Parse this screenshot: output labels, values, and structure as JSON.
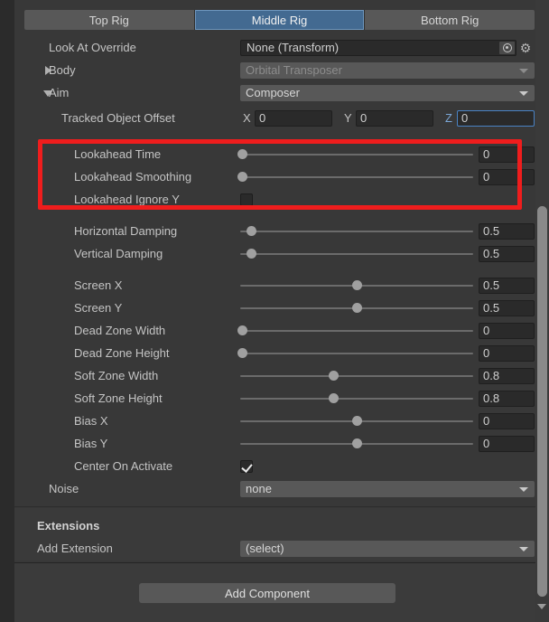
{
  "tabs": [
    {
      "label": "Top Rig",
      "active": false
    },
    {
      "label": "Middle Rig",
      "active": true
    },
    {
      "label": "Bottom Rig",
      "active": false
    }
  ],
  "look_at_override": {
    "label": "Look At Override",
    "value": "None (Transform)",
    "picker_icon": "object-picker-icon",
    "gear_icon": "gear-icon"
  },
  "body": {
    "label": "Body",
    "value": "Orbital Transposer",
    "foldout": "closed",
    "disabled": true
  },
  "aim": {
    "label": "Aim",
    "value": "Composer",
    "foldout": "open"
  },
  "tracked_object_offset": {
    "label": "Tracked Object Offset",
    "x_axis": "X",
    "x_value": "0",
    "y_axis": "Y",
    "y_value": "0",
    "z_axis": "Z",
    "z_value": "0",
    "focused_axis": "Z"
  },
  "highlight": {
    "color": "#ef1d1d",
    "note": "red-annotation-box"
  },
  "sliders": [
    {
      "label": "Lookahead Time",
      "value": "0",
      "pct": 1,
      "in_highlight": true
    },
    {
      "label": "Lookahead Smoothing",
      "value": "0",
      "pct": 1,
      "in_highlight": true
    }
  ],
  "lookahead_ignore_y": {
    "label": "Lookahead Ignore Y",
    "checked": false
  },
  "damping": [
    {
      "label": "Horizontal Damping",
      "value": "0.5",
      "pct": 5
    },
    {
      "label": "Vertical Damping",
      "value": "0.5",
      "pct": 5
    }
  ],
  "screen_settings": [
    {
      "label": "Screen X",
      "value": "0.5",
      "pct": 50
    },
    {
      "label": "Screen Y",
      "value": "0.5",
      "pct": 50
    },
    {
      "label": "Dead Zone Width",
      "value": "0",
      "pct": 1
    },
    {
      "label": "Dead Zone Height",
      "value": "0",
      "pct": 1
    },
    {
      "label": "Soft Zone Width",
      "value": "0.8",
      "pct": 40
    },
    {
      "label": "Soft Zone Height",
      "value": "0.8",
      "pct": 40
    },
    {
      "label": "Bias X",
      "value": "0",
      "pct": 50
    },
    {
      "label": "Bias Y",
      "value": "0",
      "pct": 50
    }
  ],
  "center_on_activate": {
    "label": "Center On Activate",
    "checked": true
  },
  "noise": {
    "label": "Noise",
    "value": "none"
  },
  "extensions": {
    "title": "Extensions",
    "add_label": "Add Extension",
    "add_value": "(select)"
  },
  "footer": {
    "add_component_label": "Add Component"
  },
  "scrollbar": {
    "down_arrow_icon": "chevron-down-icon"
  }
}
